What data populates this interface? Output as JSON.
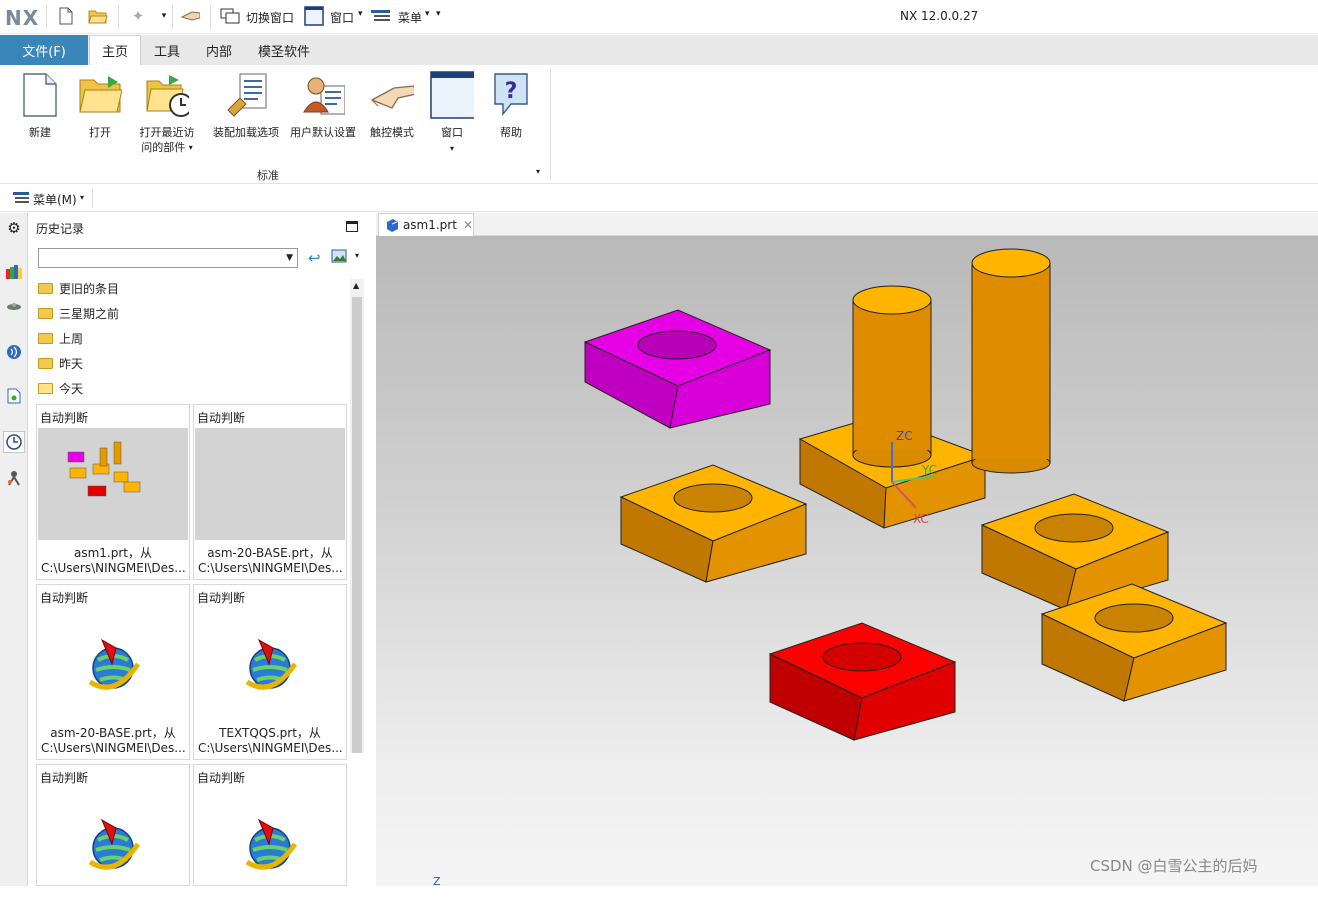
{
  "titlebar": {
    "logo": "NX",
    "switch_window_label": "切换窗口",
    "window_label": "窗口",
    "menu_label": "菜单",
    "app_title": "NX 12.0.0.27"
  },
  "tabs": {
    "file": "文件(F)",
    "items": [
      "主页",
      "工具",
      "内部",
      "模圣软件"
    ]
  },
  "ribbon": {
    "buttons": [
      {
        "label": "新建",
        "icon": "new-file-icon"
      },
      {
        "label": "打开",
        "icon": "open-folder-icon"
      },
      {
        "label": "打开最近访问的部件",
        "line1": "打开最近访",
        "line2": "问的部件",
        "icon": "recent-parts-icon"
      },
      {
        "label": "装配加载选项",
        "icon": "assembly-load-icon"
      },
      {
        "label": "用户默认设置",
        "icon": "user-defaults-icon"
      },
      {
        "label": "触控模式",
        "icon": "touch-mode-icon"
      },
      {
        "label": "窗口",
        "icon": "window-icon"
      },
      {
        "label": "帮助",
        "icon": "help-icon"
      }
    ],
    "group_label": "标准"
  },
  "menubar": {
    "label": "菜单(M)"
  },
  "history": {
    "title": "历史记录",
    "folders": [
      "更旧的条目",
      "三星期之前",
      "上周",
      "昨天",
      "今天"
    ],
    "cards": [
      {
        "header": "自动判断",
        "name": "asm1.prt，从",
        "path": "C:\\Users\\NINGMEI\\Des..."
      },
      {
        "header": "自动判断",
        "name": "asm-20-BASE.prt，从",
        "path": "C:\\Users\\NINGMEI\\Des..."
      },
      {
        "header": "自动判断",
        "name": "asm-20-BASE.prt，从",
        "path": "C:\\Users\\NINGMEI\\Des..."
      },
      {
        "header": "自动判断",
        "name": "TEXTQQS.prt，从",
        "path": "C:\\Users\\NINGMEI\\Des..."
      },
      {
        "header": "自动判断",
        "name": "",
        "path": ""
      },
      {
        "header": "自动判断",
        "name": "",
        "path": ""
      }
    ]
  },
  "viewport": {
    "tab_label": "asm1.prt",
    "axis_labels": {
      "zc": "ZC",
      "yc": "YC",
      "xc": "XC",
      "z": "Z"
    },
    "colors": {
      "magenta": "#e600e6",
      "orange": "#ffb400",
      "red": "#ff0000",
      "orange_dark": "#d88a00"
    }
  },
  "watermark": "CSDN @白雪公主的后妈"
}
